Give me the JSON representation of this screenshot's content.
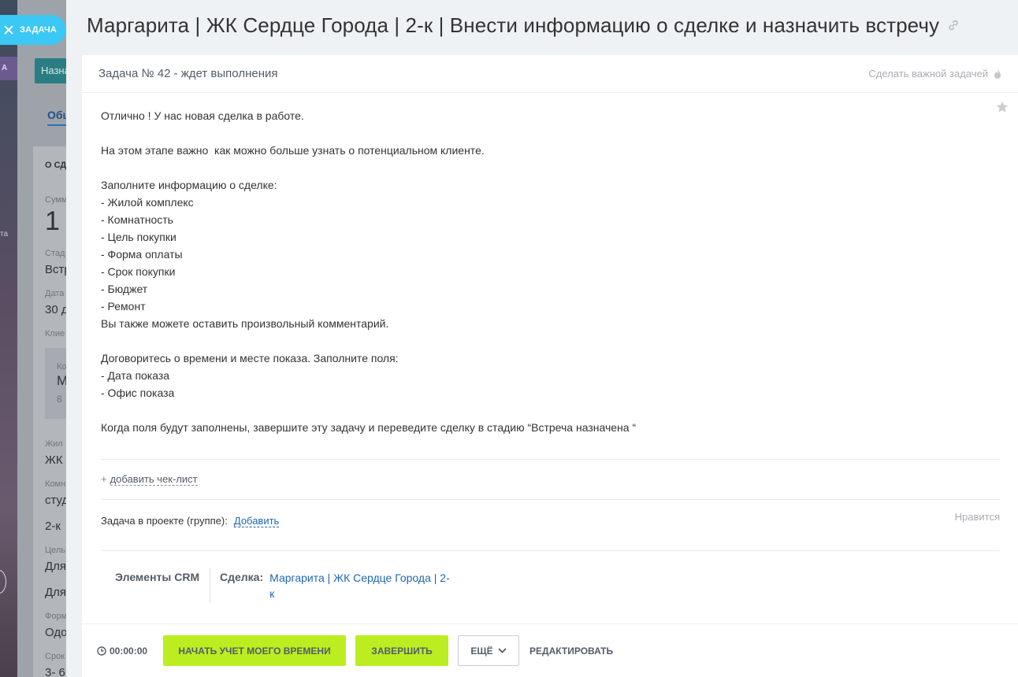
{
  "background": {
    "tag": "А",
    "button_label": "Назна",
    "tab_label": "Общ",
    "side_text": "та",
    "section_header": "О СД",
    "fields": [
      {
        "label": "Сумм",
        "value": "1"
      },
      {
        "label": "Стад",
        "value": "Встр"
      },
      {
        "label": "Дата",
        "value": "30 д"
      },
      {
        "label": "Клие",
        "value": ""
      },
      {
        "label": "Жил",
        "value": "ЖК"
      },
      {
        "label": "Комн",
        "value": "студ"
      },
      {
        "label": "",
        "value": "2-к"
      },
      {
        "label": "Цель",
        "value": "Для"
      },
      {
        "label": "",
        "value": "Для"
      },
      {
        "label": "Форм",
        "value": "Одо"
      },
      {
        "label": "Срок",
        "value": "3- 6"
      }
    ],
    "contact": {
      "label": "Ко",
      "name": "М",
      "phone": "8"
    }
  },
  "task_pill": {
    "label": "ЗАДАЧА"
  },
  "title": "Маргарита | ЖК Сердце Города | 2-к | Внести информацию о сделке и назначить встречу",
  "status": "Задача № 42 - ждет выполнения",
  "make_important": "Сделать важной задачей",
  "description": [
    "Отлично ! У нас новая сделка в работе.",
    "",
    "На этом этапе важно  как можно больше узнать о потенциальном клиенте.",
    "",
    "Заполните информацию о сделке:",
    "- Жилой комплекс",
    "- Комнатность",
    "- Цель покупки",
    "- Форма оплаты",
    "- Срок покупки",
    "- Бюджет",
    "- Ремонт",
    "Вы также можете оставить произвольный комментарий.",
    "",
    "Договоритесь о времени и месте показа. Заполните поля:",
    "- Дата показа",
    "- Офис показа",
    "",
    "Когда поля будут заполнены, завершите эту задачу и переведите сделку в стадию “Встреча назначена “"
  ],
  "checklist": {
    "plus": "+",
    "add_label": "добавить чек-лист"
  },
  "project": {
    "label": "Задача в проекте (группе):",
    "add_label": "Добавить"
  },
  "likes_label": "Нравится",
  "crm": {
    "title": "Элементы CRM",
    "deal_key": "Сделка:",
    "deal_link": "Маргарита | ЖК Сердце Города | 2-к"
  },
  "footer": {
    "timer": "00:00:00",
    "start_time": "НАЧАТЬ УЧЕТ МОЕГО ВРЕМЕНИ",
    "finish": "ЗАВЕРШИТЬ",
    "more": "ЕЩЁ",
    "edit": "РЕДАКТИРОВАТЬ"
  },
  "colors": {
    "accent_blue": "#3bc8f5",
    "button_green": "#bbed21",
    "link_blue": "#2067b0"
  }
}
